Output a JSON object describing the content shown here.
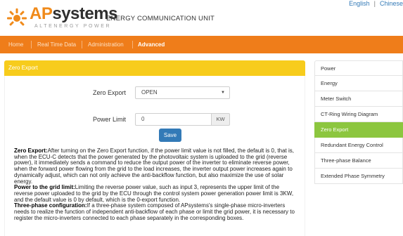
{
  "header": {
    "brand": "APsystems",
    "brand_prefix": "AP",
    "brand_suffix": "systems",
    "brand_tagline": "ALTENERGY POWER",
    "title": "ENERGY COMMUNICATION UNIT",
    "languages": [
      "English",
      "Chinese"
    ],
    "language_separator": "|"
  },
  "nav": {
    "items": [
      "Home",
      "Real Time Data",
      "Administration",
      "Advanced"
    ],
    "active": "Advanced"
  },
  "panel": {
    "title": "Zero Export",
    "zero_export_label": "Zero Export",
    "zero_export_value": "OPEN",
    "power_limit_label": "Power Limit",
    "power_limit_value": "0",
    "power_limit_unit": "KW",
    "save_label": "Save"
  },
  "description": [
    {
      "heading": "Zero Export:",
      "text": "After turning on the Zero Export function, if the power limit value is not filled, the default is 0, that is, when the ECU-C detects that the power generated by the photovoltaic system is uploaded to the grid (reverse power), it immediately sends a command to reduce the output power of the inverter to eliminate reverse power, when the forward power flowing from the grid to the load increases, the inverter output power increases again to dynamically adjust, which can not only achieve the anti-backflow function, but also maximize the use of solar energy."
    },
    {
      "heading": "Power to the grid limit:",
      "text": "Limiting the reverse power value, such as input 3, represents the upper limit of the reverse power uploaded to the grid by the ECU through the control system power generation power limit is 3KW, and the default value is 0 by default, which is the 0-export function."
    },
    {
      "heading": "Three-phase configuration:",
      "text": "If a three-phase system composed of APsystems's single-phase micro-inverters needs to realize the function of independent anti-backflow of each phase or limit the grid power, it is necessary to register the micro-inverters connected to each phase separately in the corresponding boxes."
    }
  ],
  "sidebar": {
    "items": [
      "Power",
      "Energy",
      "Meter Switch",
      "CT-Ring Wiring Diagram",
      "Zero Export",
      "Redundant Energy Control",
      "Three-phase Balance",
      "Extended Phase Symmetry"
    ],
    "active_index": 4
  },
  "colors": {
    "nav_background": "#ef7d1a",
    "panel_header": "#f7cc1c",
    "sidebar_active": "#8cc63f",
    "button_primary": "#337ab7",
    "link": "#337ab7"
  },
  "icons": {
    "logo": "apsystems-logo-icon",
    "select_caret": "caret-down-icon"
  }
}
